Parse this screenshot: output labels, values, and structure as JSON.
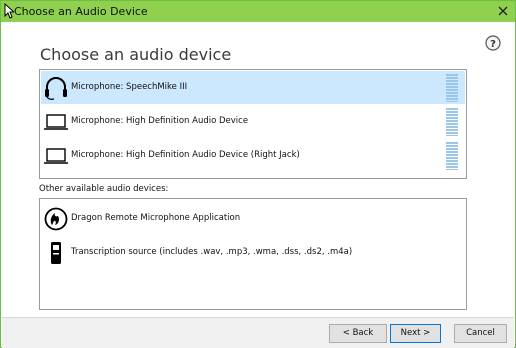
{
  "window": {
    "title": "Choose an Audio Device",
    "accent_color": "#8fd14f"
  },
  "heading": "Choose an audio device",
  "primary_devices": [
    {
      "label": "Microphone: SpeechMike III",
      "icon": "headset-icon",
      "selected": true
    },
    {
      "label": "Microphone: High Definition Audio Device",
      "icon": "laptop-icon",
      "selected": false
    },
    {
      "label": "Microphone: High Definition Audio Device (Right Jack)",
      "icon": "laptop-icon",
      "selected": false
    }
  ],
  "other_devices_label": "Other available audio devices:",
  "other_devices": [
    {
      "label": "Dragon Remote Microphone Application",
      "icon": "dragon-logo-icon"
    },
    {
      "label": "Transcription source (includes .wav, .mp3, .wma, .dss, .ds2, .m4a)",
      "icon": "recorder-icon"
    }
  ],
  "buttons": {
    "back": "< Back",
    "next": "Next >",
    "cancel": "Cancel"
  },
  "help_label": "?"
}
